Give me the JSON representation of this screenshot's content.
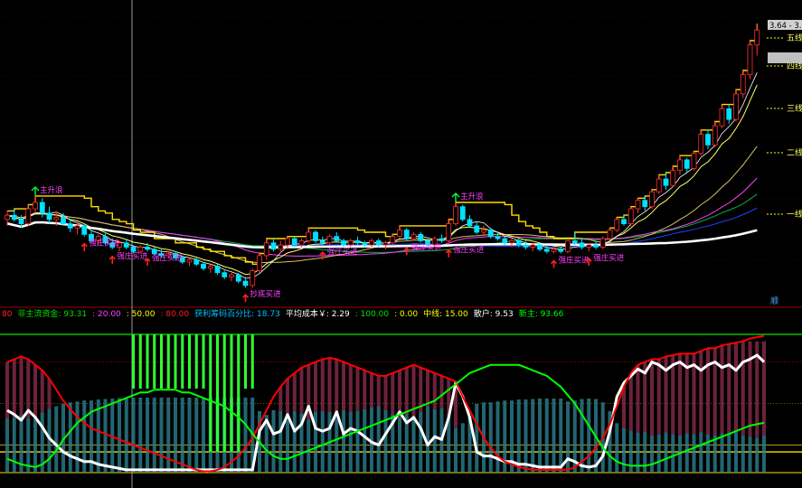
{
  "chart_data": [
    {
      "type": "candlestick",
      "panel": "main",
      "right_tags": [
        "五线",
        "四线",
        "三线",
        "二线",
        "一线"
      ],
      "right_price_labels": [
        "3.64",
        "3.60"
      ],
      "corner_tag": "顺",
      "candles": [
        [
          5.2,
          5.6,
          4.9,
          5.4
        ],
        [
          5.4,
          5.7,
          5.1,
          5.2
        ],
        [
          5.2,
          5.4,
          4.8,
          5.0
        ],
        [
          5.0,
          5.9,
          4.9,
          5.7
        ],
        [
          5.7,
          6.3,
          5.5,
          6.0
        ],
        [
          6.0,
          6.2,
          5.3,
          5.5
        ],
        [
          5.5,
          5.8,
          5.0,
          5.2
        ],
        [
          5.2,
          5.6,
          4.9,
          5.3
        ],
        [
          5.3,
          5.5,
          4.9,
          5.0
        ],
        [
          5.0,
          5.2,
          4.6,
          4.8
        ],
        [
          4.8,
          5.1,
          4.5,
          4.9
        ],
        [
          4.9,
          5.0,
          4.4,
          4.5
        ],
        [
          4.5,
          4.7,
          4.1,
          4.2
        ],
        [
          4.2,
          4.5,
          4.0,
          4.4
        ],
        [
          4.4,
          4.6,
          4.0,
          4.1
        ],
        [
          4.1,
          4.3,
          3.8,
          3.9
        ],
        [
          3.9,
          4.2,
          3.7,
          4.1
        ],
        [
          4.1,
          4.3,
          3.8,
          3.9
        ],
        [
          3.9,
          4.0,
          3.6,
          3.7
        ],
        [
          3.7,
          4.0,
          3.6,
          3.9
        ],
        [
          3.9,
          4.1,
          3.7,
          3.8
        ],
        [
          3.8,
          3.9,
          3.5,
          3.6
        ],
        [
          3.6,
          3.8,
          3.4,
          3.5
        ],
        [
          3.5,
          3.7,
          3.4,
          3.6
        ],
        [
          3.6,
          3.7,
          3.3,
          3.4
        ],
        [
          3.4,
          3.5,
          3.1,
          3.2
        ],
        [
          3.2,
          3.4,
          3.0,
          3.3
        ],
        [
          3.3,
          3.4,
          3.0,
          3.1
        ],
        [
          3.1,
          3.2,
          2.8,
          2.9
        ],
        [
          2.9,
          3.1,
          2.7,
          3.0
        ],
        [
          3.0,
          3.1,
          2.6,
          2.7
        ],
        [
          2.7,
          2.8,
          2.4,
          2.5
        ],
        [
          2.5,
          2.7,
          2.3,
          2.6
        ],
        [
          2.6,
          2.7,
          2.2,
          2.3
        ],
        [
          2.3,
          2.5,
          2.0,
          2.1
        ],
        [
          2.1,
          2.9,
          2.0,
          2.8
        ],
        [
          2.8,
          3.6,
          2.7,
          3.5
        ],
        [
          3.5,
          4.3,
          3.3,
          4.1
        ],
        [
          4.1,
          4.3,
          3.7,
          3.8
        ],
        [
          3.8,
          4.2,
          3.6,
          4.0
        ],
        [
          4.0,
          4.4,
          3.8,
          4.3
        ],
        [
          4.3,
          4.4,
          3.9,
          4.0
        ],
        [
          4.0,
          4.3,
          3.9,
          4.2
        ],
        [
          4.2,
          4.8,
          4.1,
          4.6
        ],
        [
          4.6,
          4.7,
          4.1,
          4.2
        ],
        [
          4.2,
          4.4,
          4.0,
          4.1
        ],
        [
          4.1,
          4.5,
          4.0,
          4.4
        ],
        [
          4.4,
          4.6,
          4.1,
          4.2
        ],
        [
          4.2,
          4.3,
          3.9,
          4.0
        ],
        [
          4.0,
          4.3,
          3.9,
          4.2
        ],
        [
          4.2,
          4.4,
          4.0,
          4.1
        ],
        [
          4.1,
          4.2,
          3.9,
          4.0
        ],
        [
          4.0,
          4.3,
          3.9,
          4.2
        ],
        [
          4.2,
          4.3,
          3.9,
          4.0
        ],
        [
          4.0,
          4.2,
          3.8,
          4.1
        ],
        [
          4.1,
          4.5,
          4.0,
          4.4
        ],
        [
          4.4,
          4.9,
          4.3,
          4.7
        ],
        [
          4.7,
          4.8,
          4.2,
          4.3
        ],
        [
          4.3,
          4.6,
          4.2,
          4.5
        ],
        [
          4.5,
          4.6,
          4.1,
          4.2
        ],
        [
          4.2,
          4.3,
          3.9,
          4.0
        ],
        [
          4.0,
          4.4,
          3.9,
          4.3
        ],
        [
          4.3,
          4.5,
          4.1,
          4.2
        ],
        [
          4.2,
          5.2,
          4.1,
          5.0
        ],
        [
          5.0,
          6.0,
          4.9,
          5.8
        ],
        [
          5.8,
          5.9,
          5.1,
          5.2
        ],
        [
          5.2,
          5.4,
          4.8,
          4.9
        ],
        [
          4.9,
          5.1,
          4.5,
          4.6
        ],
        [
          4.6,
          4.9,
          4.4,
          4.7
        ],
        [
          4.7,
          4.8,
          4.3,
          4.4
        ],
        [
          4.4,
          4.6,
          4.2,
          4.3
        ],
        [
          4.3,
          4.4,
          4.0,
          4.1
        ],
        [
          4.1,
          4.3,
          3.9,
          4.2
        ],
        [
          4.2,
          4.3,
          3.9,
          4.0
        ],
        [
          4.0,
          4.2,
          3.8,
          3.9
        ],
        [
          3.9,
          4.1,
          3.7,
          4.0
        ],
        [
          4.0,
          4.1,
          3.7,
          3.8
        ],
        [
          3.8,
          4.0,
          3.6,
          3.7
        ],
        [
          3.7,
          3.9,
          3.6,
          3.8
        ],
        [
          3.8,
          3.9,
          3.6,
          3.7
        ],
        [
          3.7,
          4.3,
          3.6,
          4.2
        ],
        [
          4.2,
          4.6,
          4.0,
          4.1
        ],
        [
          4.1,
          4.3,
          3.8,
          3.9
        ],
        [
          3.9,
          4.1,
          3.7,
          4.0
        ],
        [
          4.0,
          4.2,
          3.8,
          3.9
        ],
        [
          3.9,
          4.4,
          3.8,
          4.3
        ],
        [
          4.3,
          4.8,
          4.2,
          4.7
        ],
        [
          4.7,
          5.3,
          4.6,
          5.2
        ],
        [
          5.2,
          5.4,
          4.9,
          5.0
        ],
        [
          5.0,
          5.8,
          4.9,
          5.7
        ],
        [
          5.7,
          6.2,
          5.5,
          6.1
        ],
        [
          6.1,
          6.3,
          5.6,
          5.8
        ],
        [
          5.8,
          6.6,
          5.7,
          6.5
        ],
        [
          6.5,
          7.3,
          6.4,
          7.1
        ],
        [
          7.1,
          7.4,
          6.6,
          6.8
        ],
        [
          6.8,
          7.7,
          6.7,
          7.5
        ],
        [
          7.5,
          8.2,
          7.3,
          8.0
        ],
        [
          8.0,
          8.1,
          7.4,
          7.6
        ],
        [
          7.6,
          8.4,
          7.5,
          8.3
        ],
        [
          8.3,
          9.4,
          8.2,
          9.2
        ],
        [
          9.2,
          9.4,
          8.5,
          8.7
        ],
        [
          8.7,
          9.8,
          8.6,
          9.6
        ],
        [
          9.6,
          10.6,
          9.5,
          10.4
        ],
        [
          10.4,
          10.6,
          9.7,
          9.9
        ],
        [
          9.9,
          11.3,
          9.8,
          11.1
        ],
        [
          11.1,
          12.2,
          10.9,
          12.0
        ],
        [
          12.0,
          13.6,
          11.8,
          13.4
        ],
        [
          13.4,
          14.4,
          12.9,
          14.1
        ]
      ],
      "ylim": [
        1.5,
        15.0
      ],
      "signal_labels": [
        "主升浪",
        "主升浪",
        "强庄买进",
        "强庄买进",
        "强庄买进",
        "抄底买进",
        "强庄买进",
        "强庄买进",
        "强庄买进",
        "强庄买进",
        "强庄买进"
      ]
    },
    {
      "type": "line",
      "panel": "indicator",
      "legend": [
        {
          "text": "80",
          "color": "#ff2020"
        },
        {
          "text": "非主流资金: 93.31",
          "color": "#00e000"
        },
        {
          "text": ": 20.00",
          "color": "#ff40ff"
        },
        {
          "text": ": 50.00",
          "color": "#ffff00"
        },
        {
          "text": ": 80.00",
          "color": "#ff2020"
        },
        {
          "text": "获利筹码百分比: 18.73",
          "color": "#00c0ff"
        },
        {
          "text": "平均成本￥: 2.29",
          "color": "#ffffff"
        },
        {
          "text": ": 100.00",
          "color": "#00e000"
        },
        {
          "text": ": 0.00",
          "color": "#ffff00"
        },
        {
          "text": "中线: 15.00",
          "color": "#ffff00"
        },
        {
          "text": "散户: 9.53",
          "color": "#ffffff"
        },
        {
          "text": "新主: 93.66",
          "color": "#00ff00"
        }
      ],
      "ylim": [
        0,
        100
      ],
      "hlines": [
        100,
        80,
        50,
        20,
        15,
        0
      ],
      "series": [
        {
          "name": "散户",
          "color": "#ffffff",
          "values": [
            45,
            42,
            38,
            45,
            40,
            33,
            25,
            20,
            15,
            12,
            10,
            8,
            8,
            6,
            5,
            4,
            3,
            2,
            2,
            2,
            2,
            2,
            2,
            2,
            2,
            2,
            2,
            2,
            2,
            2,
            2,
            2,
            2,
            2,
            2,
            2,
            30,
            38,
            28,
            30,
            42,
            30,
            35,
            48,
            32,
            30,
            32,
            44,
            28,
            32,
            30,
            26,
            22,
            20,
            28,
            36,
            44,
            36,
            40,
            32,
            20,
            26,
            24,
            40,
            65,
            55,
            40,
            15,
            12,
            12,
            10,
            8,
            8,
            6,
            6,
            5,
            4,
            4,
            4,
            4,
            10,
            8,
            5,
            4,
            5,
            12,
            30,
            55,
            65,
            70,
            75,
            72,
            80,
            78,
            74,
            78,
            80,
            76,
            78,
            74,
            78,
            80,
            76,
            78,
            74,
            80,
            82,
            85,
            80
          ]
        },
        {
          "name": "非主流资金",
          "color": "#ff0000",
          "values": [
            80,
            82,
            84,
            82,
            78,
            74,
            68,
            60,
            52,
            46,
            40,
            36,
            32,
            30,
            28,
            26,
            24,
            22,
            20,
            18,
            16,
            14,
            12,
            10,
            8,
            6,
            4,
            2,
            1,
            1,
            2,
            4,
            8,
            12,
            18,
            25,
            35,
            45,
            55,
            62,
            68,
            72,
            76,
            78,
            80,
            82,
            83,
            82,
            80,
            78,
            76,
            74,
            72,
            70,
            70,
            72,
            74,
            76,
            78,
            76,
            74,
            72,
            70,
            68,
            66,
            55,
            45,
            35,
            25,
            18,
            12,
            8,
            6,
            4,
            3,
            2,
            2,
            2,
            2,
            2,
            2,
            4,
            8,
            12,
            18,
            25,
            35,
            48,
            62,
            72,
            78,
            80,
            82,
            82,
            84,
            85,
            86,
            86,
            86,
            88,
            90,
            90,
            92,
            93,
            94,
            95,
            97,
            98,
            99
          ]
        },
        {
          "name": "获利筹码百分比",
          "color": "#00ff00",
          "values": [
            10,
            8,
            6,
            5,
            4,
            6,
            10,
            16,
            24,
            30,
            36,
            40,
            44,
            46,
            48,
            50,
            52,
            54,
            56,
            58,
            58,
            60,
            60,
            60,
            60,
            58,
            58,
            56,
            54,
            52,
            50,
            48,
            44,
            40,
            35,
            28,
            22,
            16,
            12,
            10,
            10,
            12,
            14,
            16,
            18,
            20,
            22,
            24,
            26,
            28,
            30,
            32,
            34,
            36,
            38,
            40,
            42,
            44,
            46,
            48,
            50,
            52,
            56,
            60,
            64,
            68,
            72,
            74,
            76,
            78,
            78,
            78,
            78,
            78,
            76,
            74,
            72,
            70,
            66,
            62,
            56,
            50,
            42,
            34,
            26,
            18,
            12,
            8,
            6,
            5,
            5,
            5,
            6,
            8,
            10,
            12,
            14,
            16,
            18,
            20,
            22,
            24,
            26,
            28,
            30,
            32,
            34,
            35,
            36
          ]
        }
      ]
    }
  ]
}
